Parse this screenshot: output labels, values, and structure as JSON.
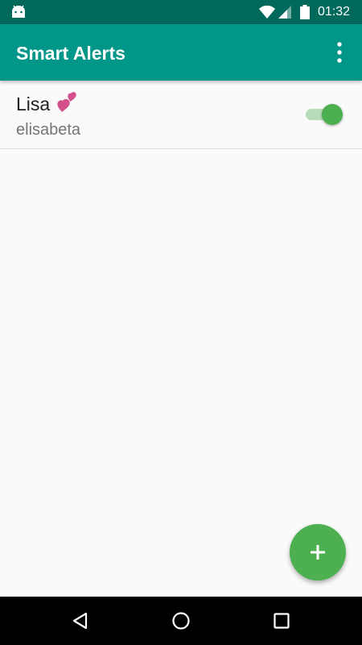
{
  "status_bar": {
    "time": "01:32",
    "icons": [
      "android-icon",
      "wifi-icon",
      "signal-icon",
      "battery-icon"
    ]
  },
  "app_bar": {
    "title": "Smart Alerts",
    "menu_icon": "more-vert-icon"
  },
  "alerts": [
    {
      "name": "Lisa",
      "emoji_icon": "two-hearts-icon",
      "subtitle": "elisabeta",
      "enabled": true
    }
  ],
  "fab": {
    "icon": "plus-icon"
  },
  "nav_bar": {
    "icons": [
      "back-icon",
      "home-icon",
      "recents-icon"
    ]
  },
  "colors": {
    "status_bar": "#00695c",
    "app_bar": "#009688",
    "accent": "#4caf50",
    "switch_track": "#a5d6a7",
    "background": "#fafafa",
    "hearts": "#d4508c"
  }
}
